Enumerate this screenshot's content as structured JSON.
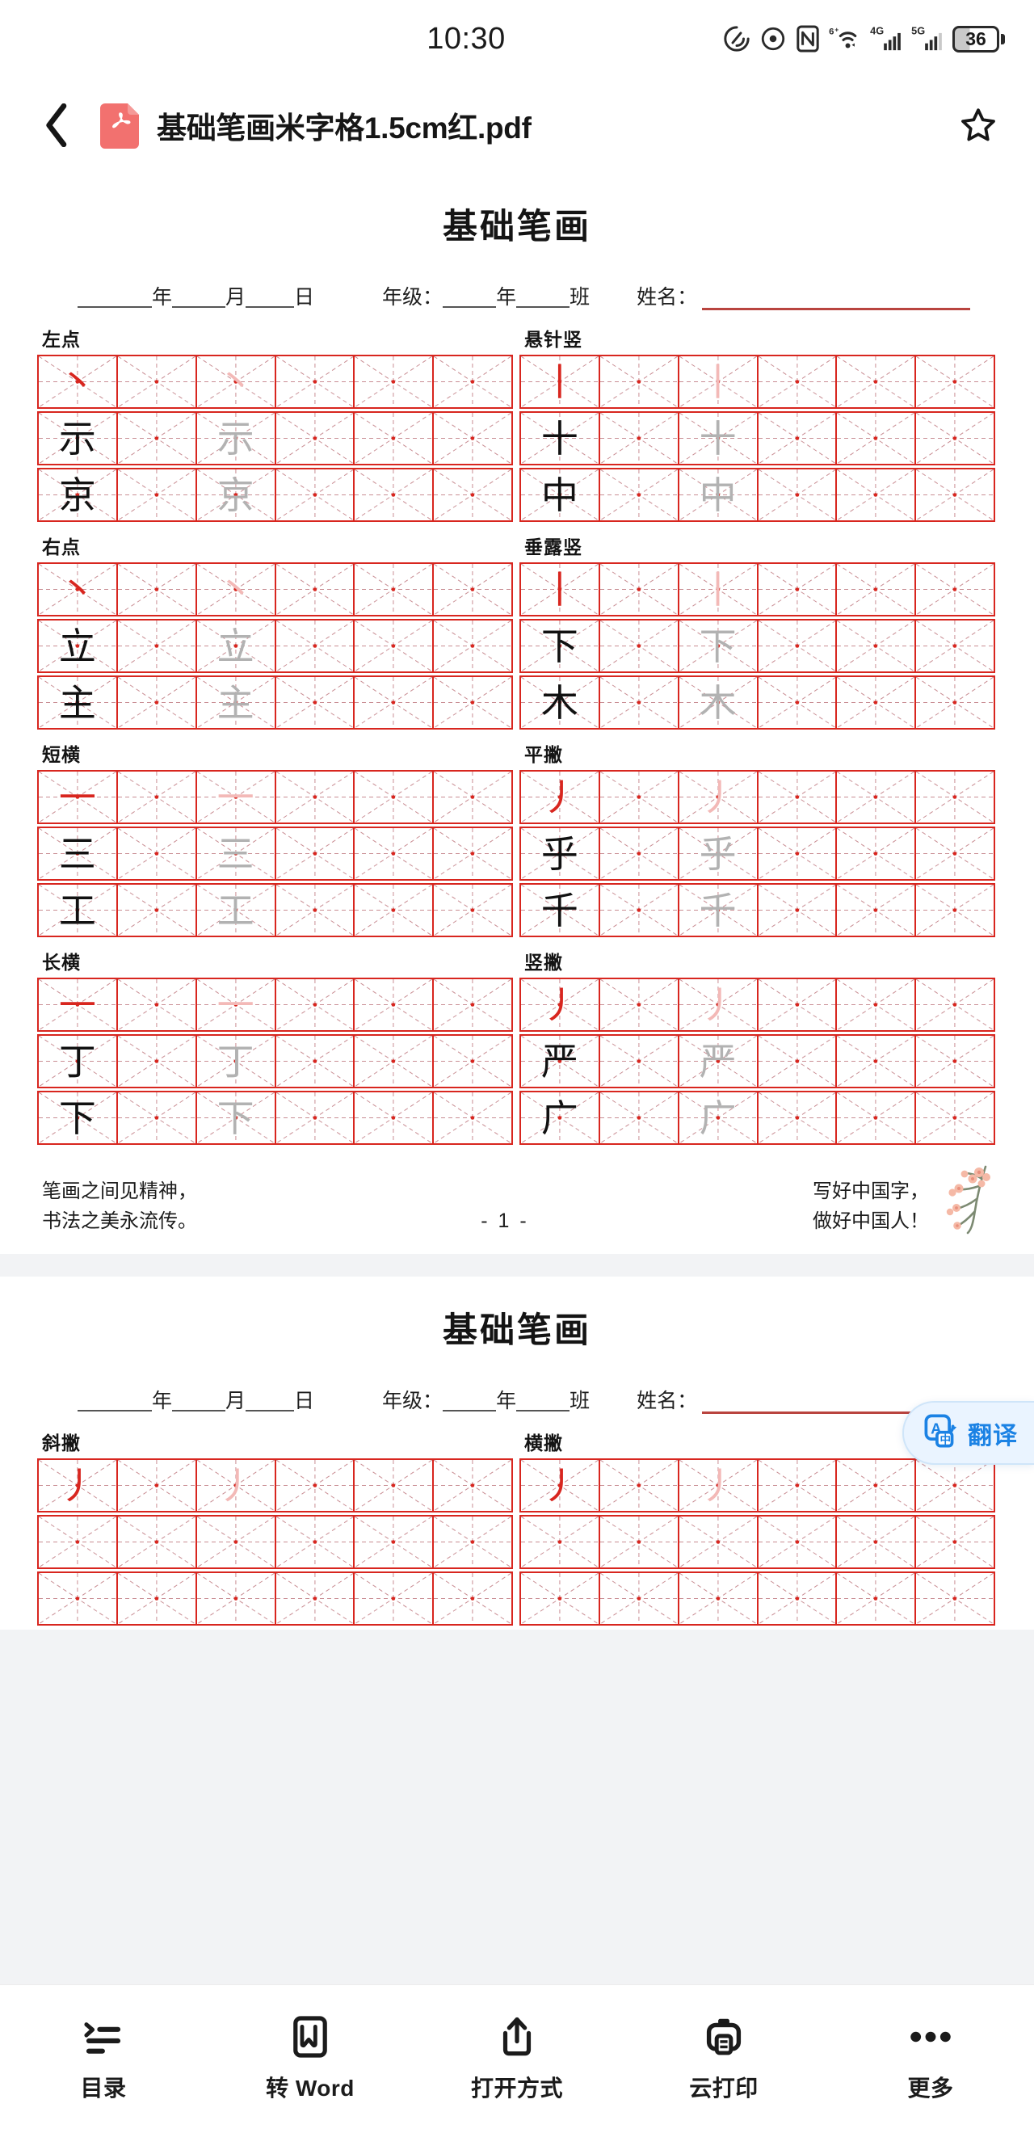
{
  "status_bar": {
    "time": "10:30",
    "battery_level": "36",
    "icons": [
      "vibrate-icon",
      "eye-comfort-icon",
      "nfc-icon",
      "wifi-6plus-icon",
      "signal-4g-icon",
      "signal-5g-icon",
      "battery-icon"
    ]
  },
  "header": {
    "back_label": "返回",
    "file_type": "PDF",
    "title": "基础笔画米字格1.5cm红.pdf",
    "favorite_label": "收藏"
  },
  "colors": {
    "grid_red": "#d8261f",
    "guide_red": "#c98d93",
    "accent_blue": "#1b82e4",
    "fab_bg": "#eaf4ff",
    "name_line": "#b9443f",
    "ink_black": "#111111",
    "ink_gray": "#b2b2b2",
    "ink_pink": "#f3b9b7"
  },
  "pages": [
    {
      "title": "基础笔画",
      "meta": {
        "date_label_year": "年",
        "date_label_month": "月",
        "date_label_day": "日",
        "grade_label": "年级：",
        "grade_unit_year": "年",
        "grade_unit_class": "班",
        "name_label": "姓名："
      },
      "groups": [
        {
          "label": "左点",
          "stroke": "丶",
          "chars": [
            "示",
            "京"
          ]
        },
        {
          "label": "悬针竖",
          "stroke": "丨",
          "chars": [
            "十",
            "中"
          ]
        },
        {
          "label": "右点",
          "stroke": "丶",
          "chars": [
            "立",
            "主"
          ]
        },
        {
          "label": "垂露竖",
          "stroke": "丨",
          "chars": [
            "下",
            "木"
          ]
        },
        {
          "label": "短横",
          "stroke": "一",
          "chars": [
            "三",
            "工"
          ]
        },
        {
          "label": "平撇",
          "stroke": "丿",
          "chars": [
            "乎",
            "千"
          ]
        },
        {
          "label": "长横",
          "stroke": "一",
          "chars": [
            "丁",
            "下"
          ]
        },
        {
          "label": "竖撇",
          "stroke": "丿",
          "chars": [
            "严",
            "广"
          ]
        }
      ],
      "footer": {
        "motto_line1": "笔画之间见精神，",
        "motto_line2": "书法之美永流传。",
        "page_number": "- 1 -",
        "slogan_line1": "写好中国字，",
        "slogan_line2": "做好中国人！"
      }
    },
    {
      "title": "基础笔画",
      "meta": {
        "date_label_year": "年",
        "date_label_month": "月",
        "date_label_day": "日",
        "grade_label": "年级：",
        "grade_unit_year": "年",
        "grade_unit_class": "班",
        "name_label": "姓名："
      },
      "groups": [
        {
          "label": "斜撇",
          "stroke": "丿",
          "chars": [
            "",
            ""
          ]
        },
        {
          "label": "横撇",
          "stroke": "丿",
          "chars": [
            "",
            ""
          ]
        }
      ]
    }
  ],
  "translate_fab": {
    "label": "翻译",
    "icon": "translate-icon"
  },
  "toolbar": {
    "items": [
      {
        "label": "目录",
        "icon": "list-icon"
      },
      {
        "label": "转 Word",
        "icon": "word-doc-icon"
      },
      {
        "label": "打开方式",
        "icon": "share-open-icon"
      },
      {
        "label": "云打印",
        "icon": "printer-icon"
      },
      {
        "label": "更多",
        "icon": "more-dots-icon"
      }
    ]
  }
}
